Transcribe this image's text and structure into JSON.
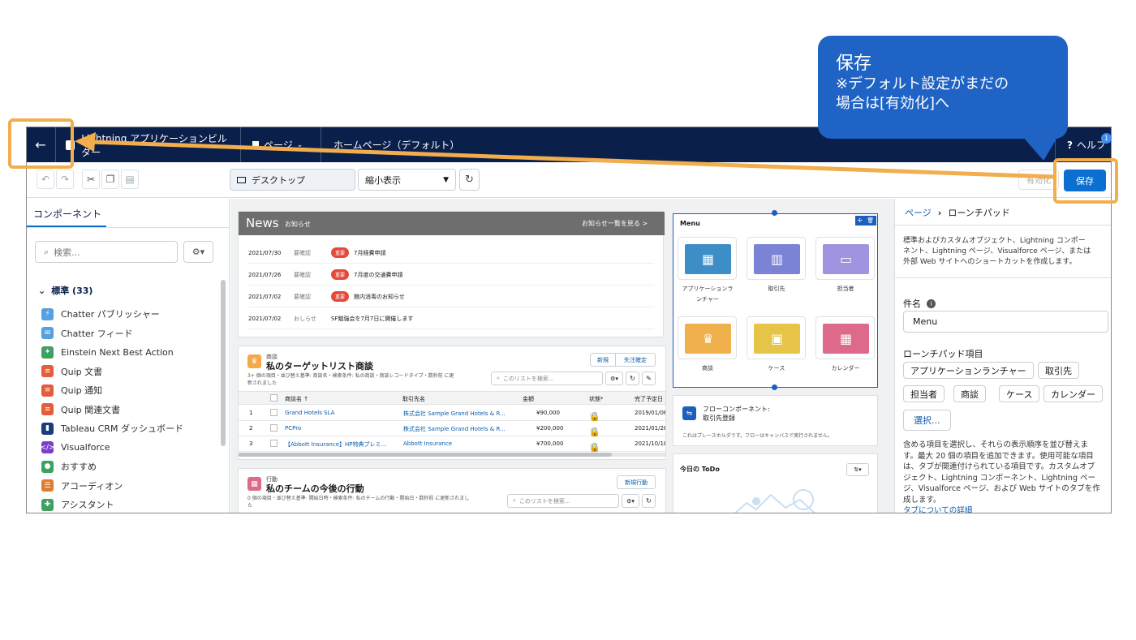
{
  "callout": {
    "title": "保存",
    "line1": "※デフォルト設定がまだの",
    "line2": "場合は[有効化]へ"
  },
  "topbar": {
    "back_icon": "←",
    "app_name": "Lightning アプリケーションビルダー",
    "page_menu": "ページ",
    "page_name": "ホームページ（デフォルト）",
    "help": "ヘルプ",
    "help_badge": "1"
  },
  "toolbar": {
    "device": "デスクトップ",
    "view": "縮小表示",
    "activate": "有効化",
    "save": "保存"
  },
  "left": {
    "tab": "コンポーネント",
    "search_placeholder": "検索...",
    "section": "標準 (33)",
    "items": [
      {
        "label": "Chatter パブリッシャー",
        "color": "#54a0e0",
        "icon": "lightning-icon"
      },
      {
        "label": "Chatter フィード",
        "color": "#54a0e0",
        "icon": "chat-icon"
      },
      {
        "label": "Einstein Next Best Action",
        "color": "#3fa064",
        "icon": "einstein-icon"
      },
      {
        "label": "Quip 文書",
        "color": "#e35d3c",
        "icon": "quip-icon"
      },
      {
        "label": "Quip 通知",
        "color": "#e35d3c",
        "icon": "quip-icon"
      },
      {
        "label": "Quip 関連文書",
        "color": "#e35d3c",
        "icon": "quip-icon"
      },
      {
        "label": "Tableau CRM ダッシュボード",
        "color": "#1b3c7a",
        "icon": "chart-icon"
      },
      {
        "label": "Visualforce",
        "color": "#7b3fc8",
        "icon": "code-icon"
      },
      {
        "label": "おすすめ",
        "color": "#3fa064",
        "icon": "lightbulb-icon"
      },
      {
        "label": "アコーディオン",
        "color": "#e07c2c",
        "icon": "accordion-icon"
      },
      {
        "label": "アシスタント",
        "color": "#3fa064",
        "icon": "assistant-icon"
      }
    ]
  },
  "news": {
    "title": "News",
    "subtitle": "お知らせ",
    "link": "お知らせ一覧を見る >",
    "rows": [
      {
        "date": "2021/07/30",
        "type": "要確認",
        "badge": "重要",
        "text": "7月経費申請"
      },
      {
        "date": "2021/07/26",
        "type": "要確認",
        "badge": "重要",
        "text": "7月度の交通費申請"
      },
      {
        "date": "2021/07/02",
        "type": "要確認",
        "badge": "重要",
        "text": "館内消毒のお知らせ"
      },
      {
        "date": "2021/07/02",
        "type": "おしらせ",
        "badge": "",
        "text": "SF勉強会を7月7日に開催します"
      }
    ]
  },
  "opps": {
    "kicker": "商談",
    "title": "私のターゲットリスト商談",
    "desc1": "3+ 個の項目・並び替え基準: 商談名・検索条件: 私の商談・商談レコードタイプ・数秒前 に更",
    "desc2": "新されました",
    "btn_new": "新規",
    "btn_lost": "失注確定",
    "search": "このリストを検索...",
    "cols": [
      "商談名 ↑",
      "取引先名",
      "金額",
      "状態*",
      "完了予定日"
    ],
    "rows": [
      {
        "no": "1",
        "name": "Grand Hotels SLA",
        "account": "株式会社 Sample Grand Hotels & R...",
        "amount": "¥90,000",
        "date": "2019/01/06"
      },
      {
        "no": "2",
        "name": "PCPro",
        "account": "株式会社 Sample Grand Hotels & R...",
        "amount": "¥200,000",
        "date": "2021/01/28"
      },
      {
        "no": "3",
        "name": "【Abbott Insurance】HP特典プレミ...",
        "account": "Abbott Insurance",
        "amount": "¥700,000",
        "date": "2021/10/18"
      }
    ]
  },
  "actions": {
    "kicker": "行動",
    "title": "私のチームの今後の行動",
    "desc1": "0 個の項目・並び替え基準: 開始日時・検索条件: 私のチームの行動・開始日・数秒前 に更新されまし",
    "desc2": "た",
    "btn_new": "新規行動",
    "search": "このリストを検索..."
  },
  "menu": {
    "title": "Menu",
    "tiles": [
      {
        "label": "アプリケーションラ",
        "label2": "ンチャー",
        "color": "#3d8dc7",
        "icon": "grid-icon"
      },
      {
        "label": "取引先",
        "label2": "",
        "color": "#7a83d6",
        "icon": "building-icon"
      },
      {
        "label": "担当者",
        "label2": "",
        "color": "#a094e0",
        "icon": "contact-card-icon"
      },
      {
        "label": "商談",
        "label2": "",
        "color": "#f0b04c",
        "icon": "crown-icon"
      },
      {
        "label": "ケース",
        "label2": "",
        "color": "#e6c448",
        "icon": "briefcase-icon"
      },
      {
        "label": "カレンダー",
        "label2": "",
        "color": "#dd6a8a",
        "icon": "calendar-icon"
      }
    ]
  },
  "flow": {
    "title1": "フローコンポーネント:",
    "title2": "取引先登録",
    "desc": "これはプレースホルダです。フローはキャンバスで実行されません。"
  },
  "todo": {
    "title": "今日の ToDo"
  },
  "right": {
    "crumb_page": "ページ",
    "crumb_current": "ローンチパッド",
    "desc": [
      "標準およびカスタムオブジェクト、Lightning コンポー",
      "ネント、Lightning ページ、Visualforce ページ、または",
      "外部 Web サイトへのショートカットを作成します。"
    ],
    "name_label": "件名",
    "name_value": "Menu",
    "items_label": "ローンチパッド項目",
    "items": [
      "アプリケーションランチャー",
      "取引先",
      "担当者",
      "商談",
      "ケース",
      "カレンダー"
    ],
    "select_btn": "選択...",
    "help": [
      "含める項目を選択し、それらの表示順序を並び替えま",
      "す。最大 20 個の項目を追加できます。使用可能な項目",
      "は、タブが関連付けられている項目です。カスタムオブ",
      "ジェクト、Lightning コンポーネント、Lightning ペー",
      "ジ、Visualforce ページ、および Web サイトのタブを作",
      "成します。"
    ],
    "help_link": "タブについての詳細"
  }
}
